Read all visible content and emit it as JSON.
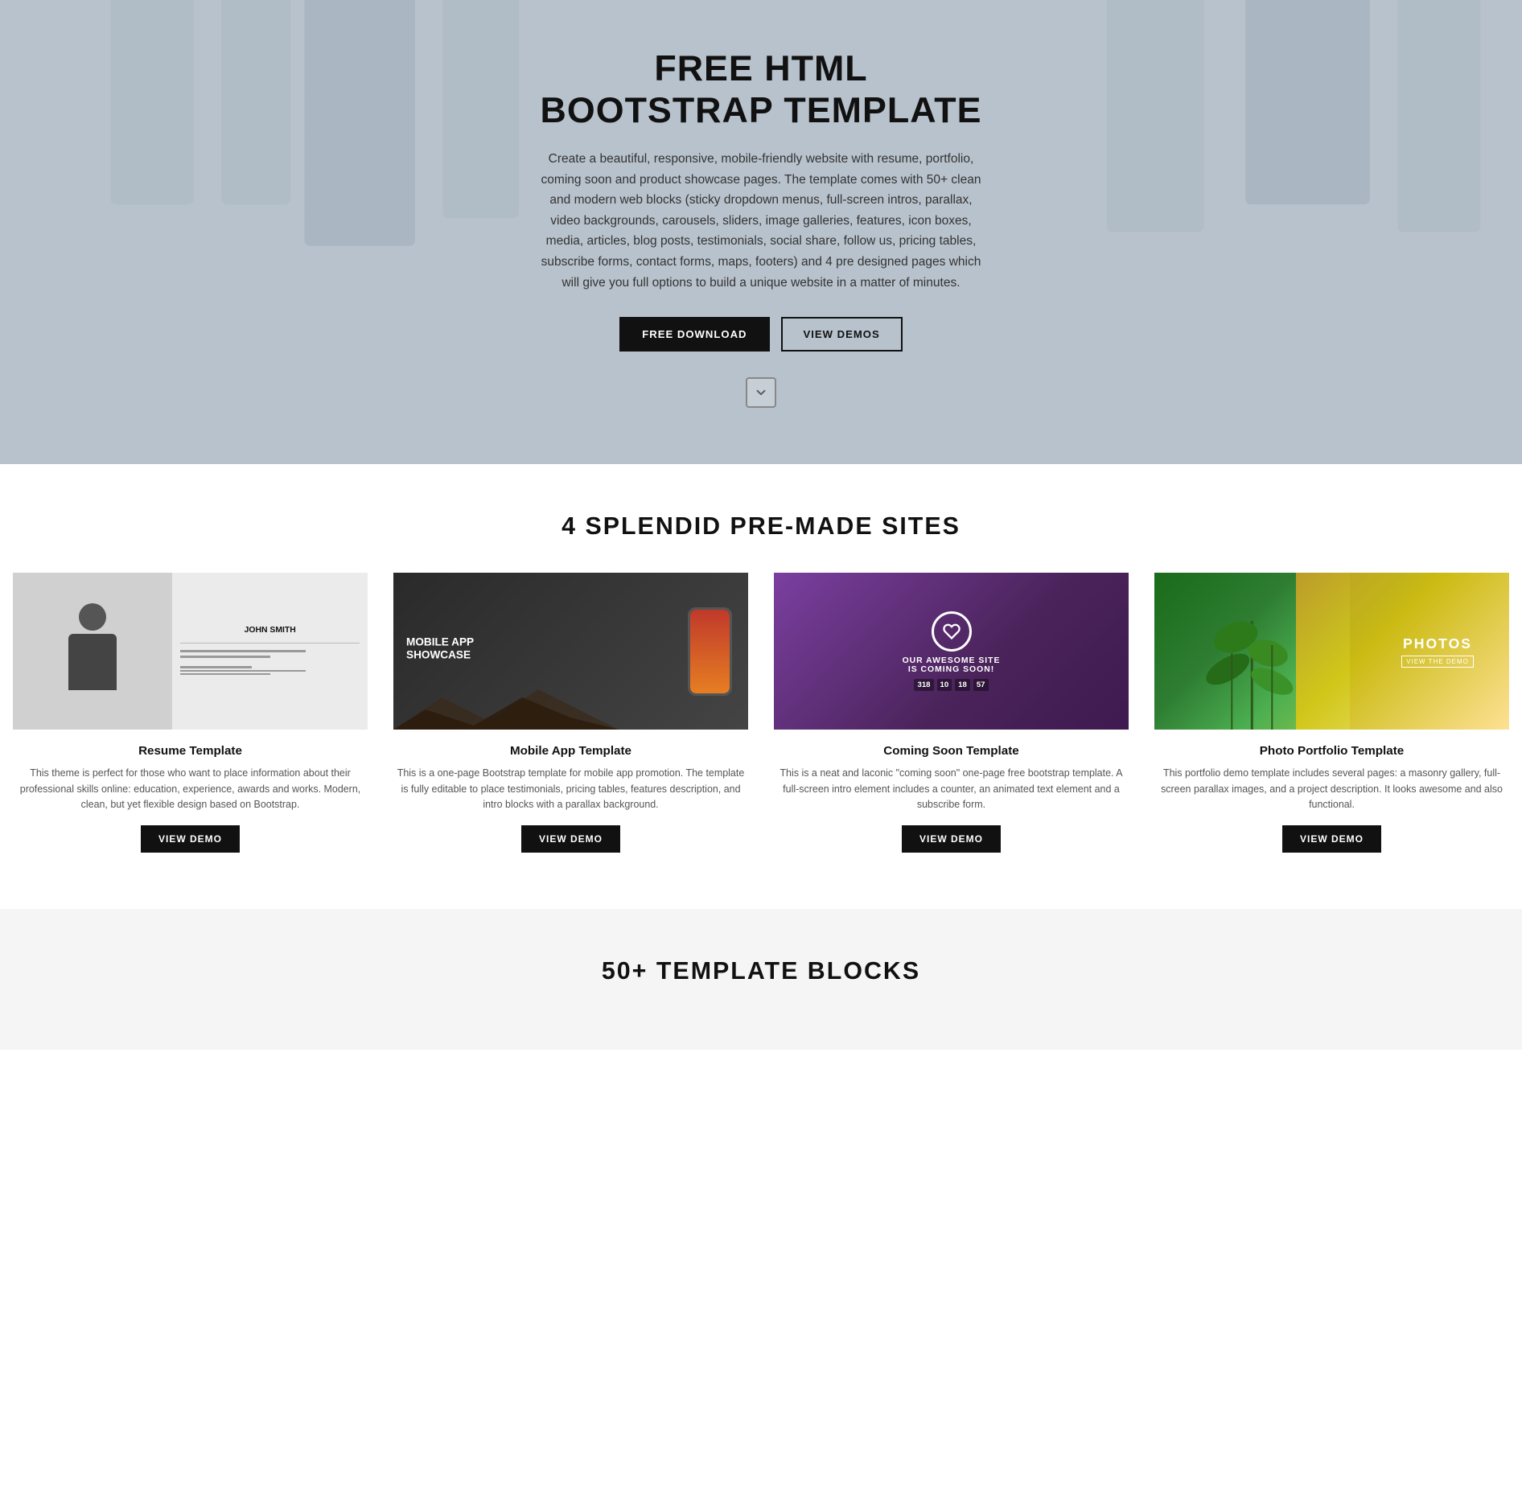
{
  "hero": {
    "title": "FREE HTML BOOTSTRAP TEMPLATE",
    "description": "Create a beautiful, responsive, mobile-friendly website with resume, portfolio, coming soon and product showcase pages. The template comes with 50+ clean and modern web blocks (sticky dropdown menus, full-screen intros, parallax, video backgrounds, carousels, sliders, image galleries, features, icon boxes, media, articles, blog posts, testimonials, social share, follow us, pricing tables, subscribe forms, contact forms, maps, footers) and 4 pre designed pages which will give you full options to build a unique website in a matter of minutes.",
    "btn_download": "FREE DOWNLOAD",
    "btn_demos": "VIEW DEMOS",
    "scroll_icon": "chevron-down"
  },
  "premade": {
    "section_title": "4 SPLENDID PRE-MADE SITES",
    "cards": [
      {
        "id": "resume",
        "title": "Resume Template",
        "description": "This theme is perfect for those who want to place information about their professional skills online: education, experience, awards and works. Modern, clean, but yet flexible design based on Bootstrap.",
        "btn_label": "VIEW DEMO",
        "thumb_name": "John Smith",
        "thumb_label": "JOHN SMITH"
      },
      {
        "id": "mobile",
        "title": "Mobile App Template",
        "description": "This is a one-page Bootstrap template for mobile app promotion. The template is fully editable to place testimonials, pricing tables, features description, and intro blocks with a parallax background.",
        "btn_label": "VIEW DEMO",
        "thumb_headline_line1": "MOBILE APP",
        "thumb_headline_line2": "SHOWCASE"
      },
      {
        "id": "coming",
        "title": "Coming Soon Template",
        "description": "This is a neat and laconic \"coming soon\" one-page free bootstrap template. A full-screen intro element includes a counter, an animated text element and a subscribe form.",
        "btn_label": "VIEW DEMO",
        "thumb_text": "OUR AWESOME SITE IS COMING SOON!",
        "counter": [
          "318",
          "10",
          "18",
          "57"
        ]
      },
      {
        "id": "photo",
        "title": "Photo Portfolio Template",
        "description": "This portfolio demo template includes several pages: a masonry gallery, full-screen parallax images, and a project description. It looks awesome and also functional.",
        "btn_label": "VIEW DEMO",
        "thumb_main": "PHOTOS",
        "thumb_sub": "VIEW THE DEMO"
      }
    ]
  },
  "blocks": {
    "section_title": "50+ TEMPLATE BLOCKS"
  }
}
